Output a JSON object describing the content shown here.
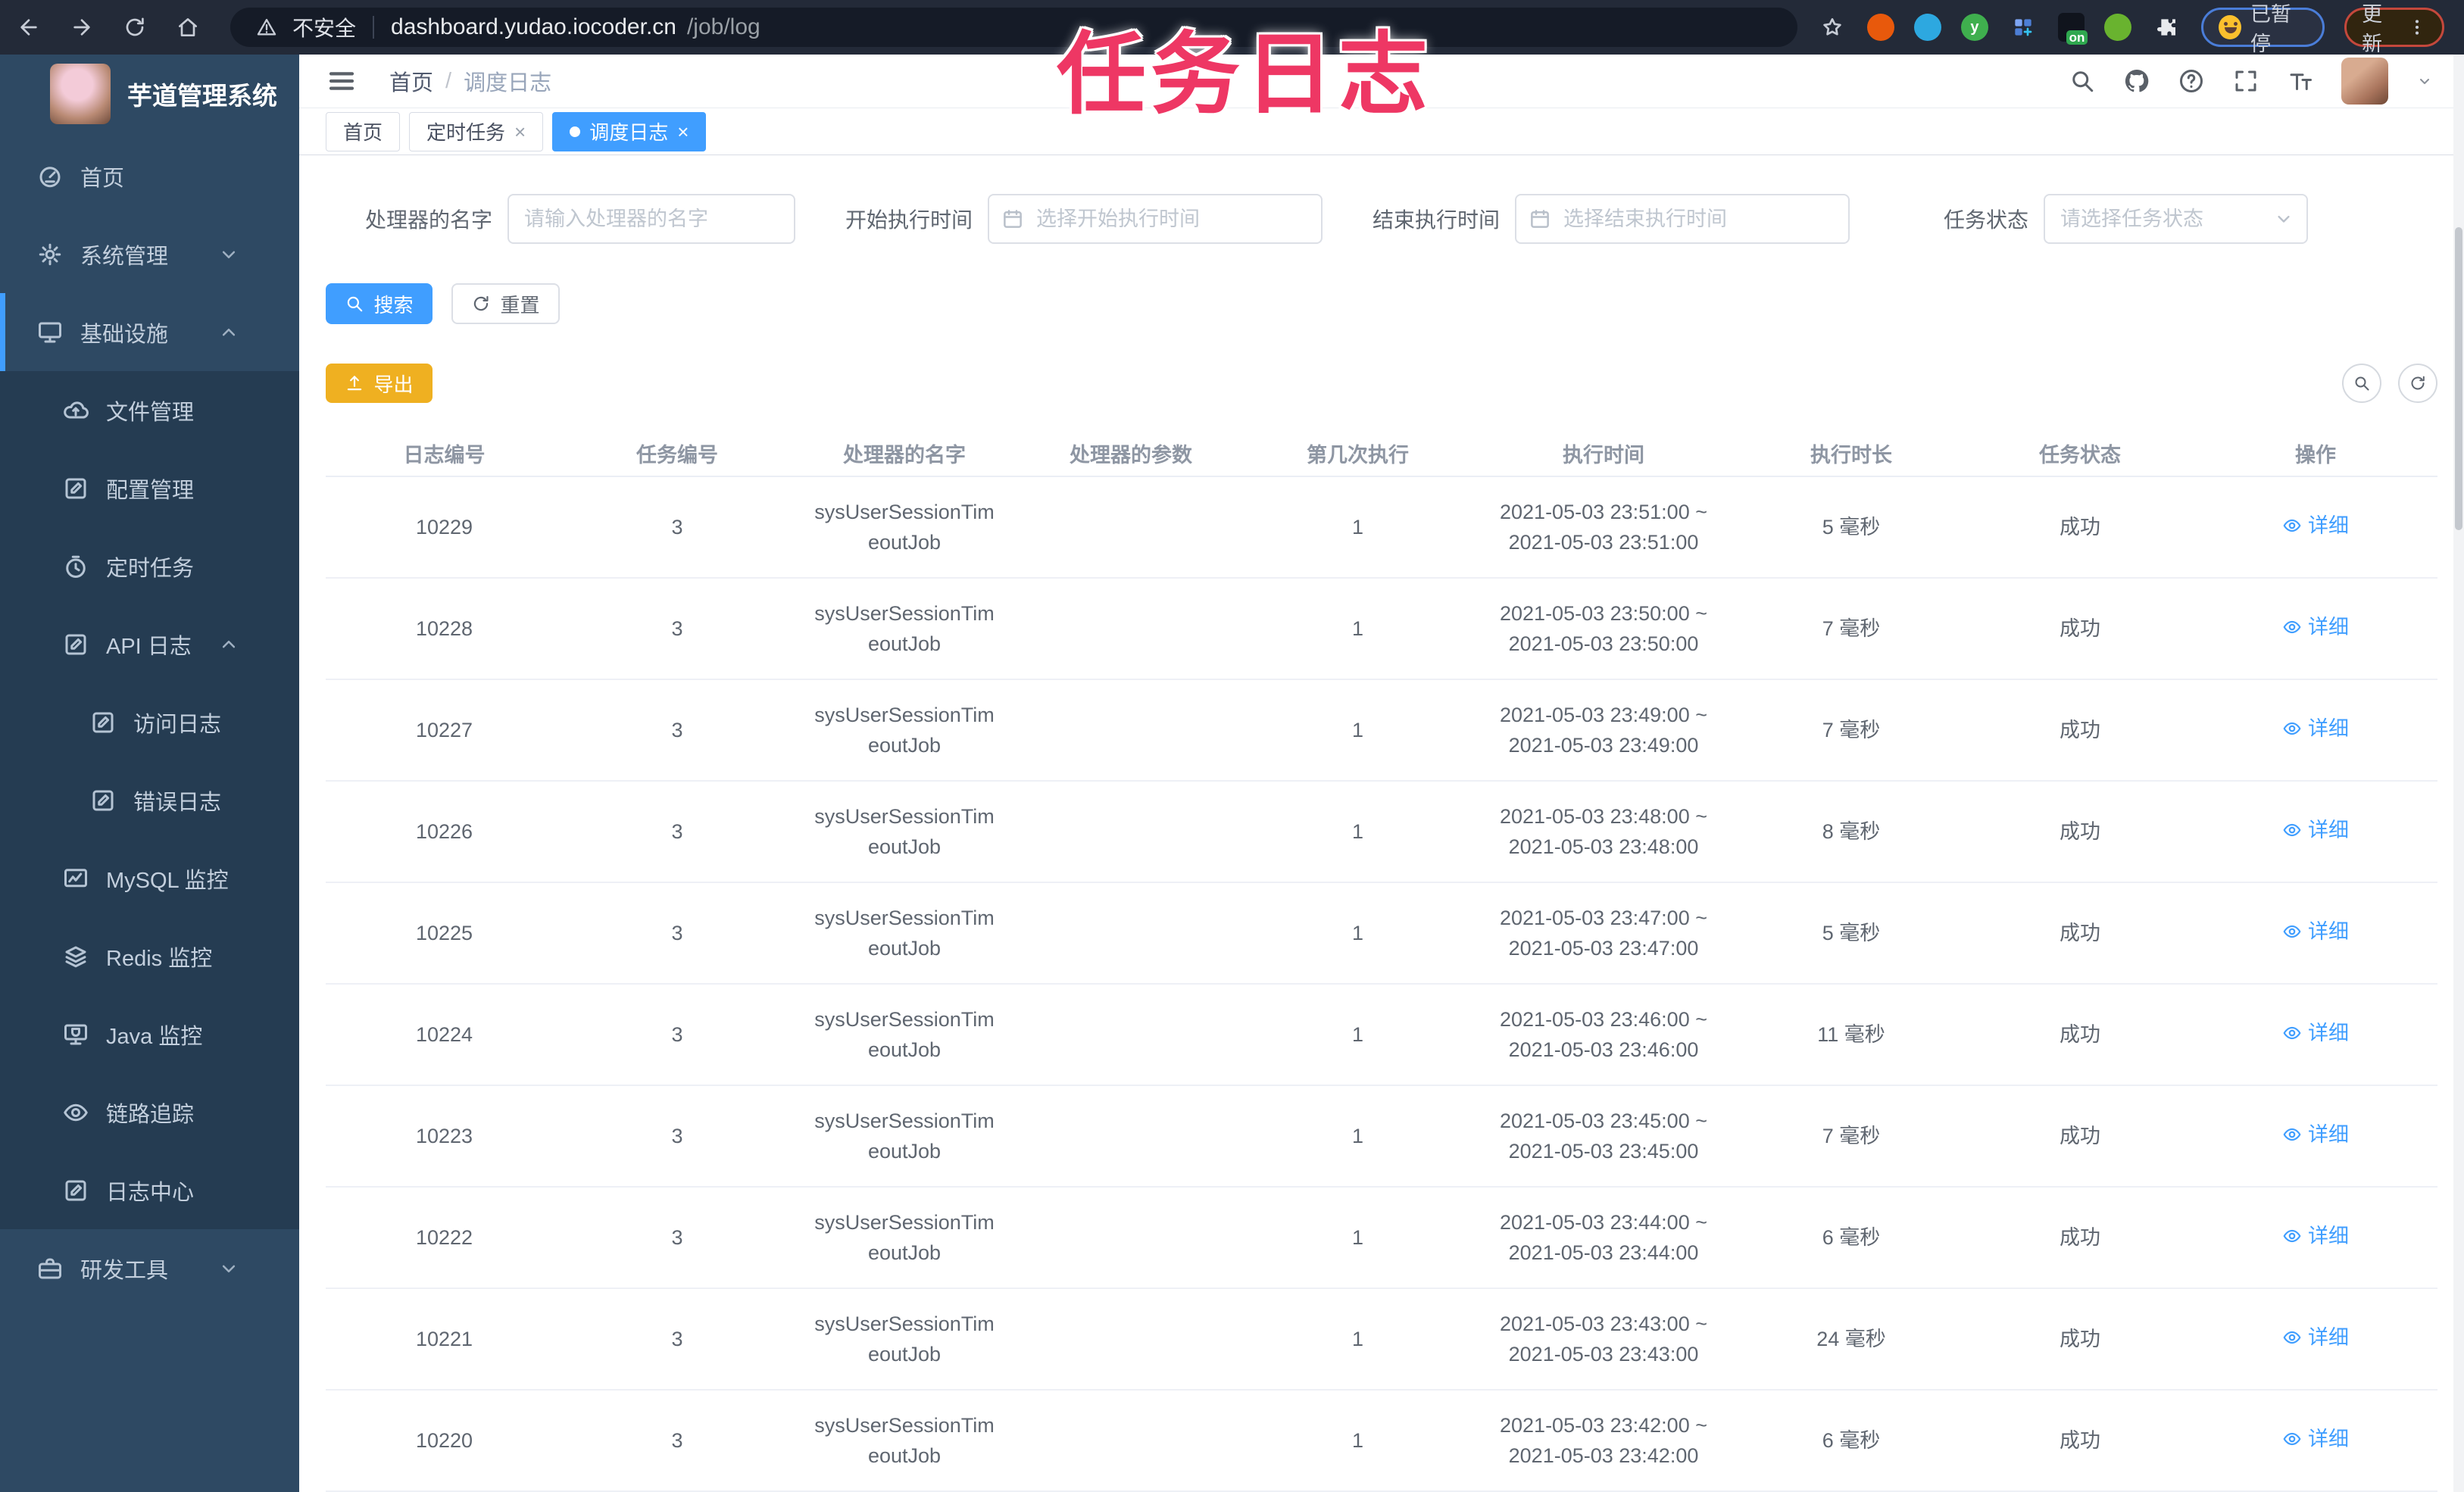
{
  "overlay": {
    "title": "任务日志",
    "color": "#ee3764"
  },
  "browser": {
    "security_label": "不安全",
    "url_host": "dashboard.yudao.iocoder.cn",
    "url_path": "/job/log",
    "ext_y_label": "y",
    "ext_on_label": "on",
    "paused_label": "已暂停",
    "update_label": "更新"
  },
  "sidebar": {
    "app_title": "芋道管理系统",
    "items": [
      {
        "label": "首页",
        "icon": "dashboard",
        "level": 1,
        "chevron": ""
      },
      {
        "label": "系统管理",
        "icon": "gear",
        "level": 1,
        "chevron": "down"
      },
      {
        "label": "基础设施",
        "icon": "monitor",
        "level": 1,
        "chevron": "up",
        "active": true
      },
      {
        "label": "文件管理",
        "icon": "cloud-up",
        "level": 2,
        "chevron": ""
      },
      {
        "label": "配置管理",
        "icon": "edit",
        "level": 2,
        "chevron": ""
      },
      {
        "label": "定时任务",
        "icon": "timer",
        "level": 2,
        "chevron": ""
      },
      {
        "label": "API 日志",
        "icon": "edit",
        "level": 2,
        "chevron": "up"
      },
      {
        "label": "访问日志",
        "icon": "edit",
        "level": 3,
        "chevron": ""
      },
      {
        "label": "错误日志",
        "icon": "edit",
        "level": 3,
        "chevron": ""
      },
      {
        "label": "MySQL 监控",
        "icon": "chart",
        "level": 2,
        "chevron": ""
      },
      {
        "label": "Redis 监控",
        "icon": "stack",
        "level": 2,
        "chevron": ""
      },
      {
        "label": "Java 监控",
        "icon": "javamon",
        "level": 2,
        "chevron": ""
      },
      {
        "label": "链路追踪",
        "icon": "eye",
        "level": 2,
        "chevron": ""
      },
      {
        "label": "日志中心",
        "icon": "edit",
        "level": 2,
        "chevron": ""
      },
      {
        "label": "研发工具",
        "icon": "suitcase",
        "level": 1,
        "chevron": "down"
      }
    ]
  },
  "navbar": {
    "breadcrumb_home": "首页",
    "breadcrumb_separator": "/",
    "breadcrumb_current": "调度日志"
  },
  "tabs": [
    {
      "label": "首页",
      "closable": false,
      "active": false
    },
    {
      "label": "定时任务",
      "closable": true,
      "active": false
    },
    {
      "label": "调度日志",
      "closable": true,
      "active": true
    }
  ],
  "filters": {
    "handler_label": "处理器的名字",
    "handler_placeholder": "请输入处理器的名字",
    "start_label": "开始执行时间",
    "start_placeholder": "选择开始执行时间",
    "end_label": "结束执行时间",
    "end_placeholder": "选择结束执行时间",
    "status_label": "任务状态",
    "status_placeholder": "请选择任务状态",
    "search_label": "搜索",
    "reset_label": "重置"
  },
  "toolbar": {
    "export_label": "导出"
  },
  "table": {
    "columns": [
      "日志编号",
      "任务编号",
      "处理器的名字",
      "处理器的参数",
      "第几次执行",
      "执行时间",
      "执行时长",
      "任务状态",
      "操作"
    ],
    "detail_label": "详细",
    "rows": [
      {
        "id": "10229",
        "job_id": "3",
        "handler_line1": "sysUserSessionTim",
        "handler_line2": "eoutJob",
        "param": "",
        "attempt": "1",
        "time1": "2021-05-03 23:51:00 ~",
        "time2": "2021-05-03 23:51:00",
        "duration": "5 毫秒",
        "status": "成功"
      },
      {
        "id": "10228",
        "job_id": "3",
        "handler_line1": "sysUserSessionTim",
        "handler_line2": "eoutJob",
        "param": "",
        "attempt": "1",
        "time1": "2021-05-03 23:50:00 ~",
        "time2": "2021-05-03 23:50:00",
        "duration": "7 毫秒",
        "status": "成功"
      },
      {
        "id": "10227",
        "job_id": "3",
        "handler_line1": "sysUserSessionTim",
        "handler_line2": "eoutJob",
        "param": "",
        "attempt": "1",
        "time1": "2021-05-03 23:49:00 ~",
        "time2": "2021-05-03 23:49:00",
        "duration": "7 毫秒",
        "status": "成功"
      },
      {
        "id": "10226",
        "job_id": "3",
        "handler_line1": "sysUserSessionTim",
        "handler_line2": "eoutJob",
        "param": "",
        "attempt": "1",
        "time1": "2021-05-03 23:48:00 ~",
        "time2": "2021-05-03 23:48:00",
        "duration": "8 毫秒",
        "status": "成功"
      },
      {
        "id": "10225",
        "job_id": "3",
        "handler_line1": "sysUserSessionTim",
        "handler_line2": "eoutJob",
        "param": "",
        "attempt": "1",
        "time1": "2021-05-03 23:47:00 ~",
        "time2": "2021-05-03 23:47:00",
        "duration": "5 毫秒",
        "status": "成功"
      },
      {
        "id": "10224",
        "job_id": "3",
        "handler_line1": "sysUserSessionTim",
        "handler_line2": "eoutJob",
        "param": "",
        "attempt": "1",
        "time1": "2021-05-03 23:46:00 ~",
        "time2": "2021-05-03 23:46:00",
        "duration": "11 毫秒",
        "status": "成功"
      },
      {
        "id": "10223",
        "job_id": "3",
        "handler_line1": "sysUserSessionTim",
        "handler_line2": "eoutJob",
        "param": "",
        "attempt": "1",
        "time1": "2021-05-03 23:45:00 ~",
        "time2": "2021-05-03 23:45:00",
        "duration": "7 毫秒",
        "status": "成功"
      },
      {
        "id": "10222",
        "job_id": "3",
        "handler_line1": "sysUserSessionTim",
        "handler_line2": "eoutJob",
        "param": "",
        "attempt": "1",
        "time1": "2021-05-03 23:44:00 ~",
        "time2": "2021-05-03 23:44:00",
        "duration": "6 毫秒",
        "status": "成功"
      },
      {
        "id": "10221",
        "job_id": "3",
        "handler_line1": "sysUserSessionTim",
        "handler_line2": "eoutJob",
        "param": "",
        "attempt": "1",
        "time1": "2021-05-03 23:43:00 ~",
        "time2": "2021-05-03 23:43:00",
        "duration": "24 毫秒",
        "status": "成功"
      },
      {
        "id": "10220",
        "job_id": "3",
        "handler_line1": "sysUserSessionTim",
        "handler_line2": "eoutJob",
        "param": "",
        "attempt": "1",
        "time1": "2021-05-03 23:42:00 ~",
        "time2": "2021-05-03 23:42:00",
        "duration": "6 毫秒",
        "status": "成功"
      }
    ]
  },
  "colors": {
    "accent": "#409eff",
    "warning": "#efb021",
    "overlay_pink": "#ee3764",
    "sidebar_bg": "#2e4963",
    "sidebar_sub_bg": "#253c52"
  }
}
